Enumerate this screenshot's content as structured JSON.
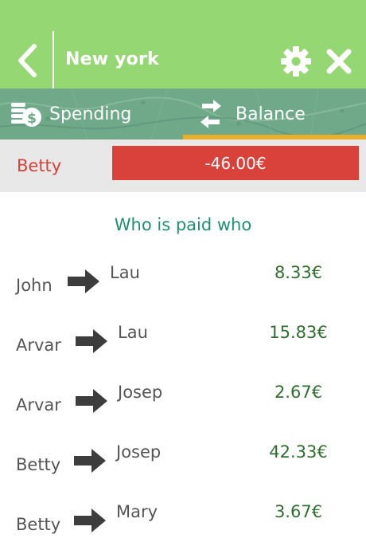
{
  "header": {
    "title": "New york",
    "back_icon": "chevron-left-icon",
    "settings_icon": "gear-icon",
    "close_icon": "close-icon",
    "background": "#95d873"
  },
  "tabs": [
    {
      "label": "Spending",
      "icon": "coins-dollar-icon",
      "active": false
    },
    {
      "label": "Balance",
      "icon": "swap-arrows-icon",
      "active": true
    }
  ],
  "balance": {
    "name": "Betty",
    "amount": "-46.00€",
    "color": "#d9423a"
  },
  "section_title": "Who is paid who",
  "payments": [
    {
      "from": "John",
      "to": "Lau",
      "amount": "8.33€"
    },
    {
      "from": "Arvar",
      "to": "Lau",
      "amount": "15.83€"
    },
    {
      "from": "Arvar",
      "to": "Josep",
      "amount": "2.67€"
    },
    {
      "from": "Betty",
      "to": "Josep",
      "amount": "42.33€"
    },
    {
      "from": "Betty",
      "to": "Mary",
      "amount": "3.67€"
    }
  ]
}
